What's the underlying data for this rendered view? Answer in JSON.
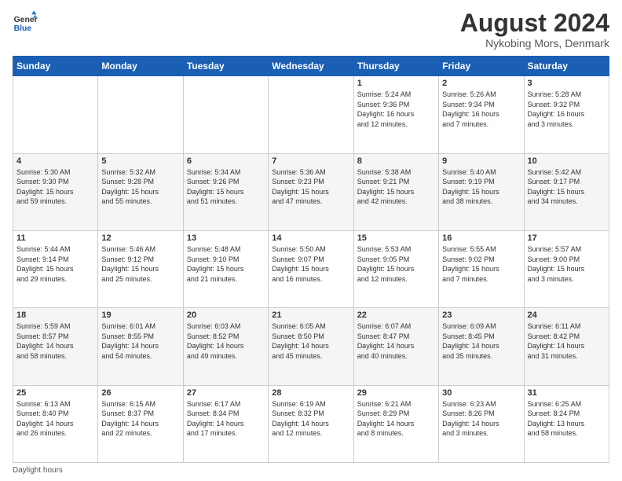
{
  "header": {
    "logo_line1": "General",
    "logo_line2": "Blue",
    "title": "August 2024",
    "subtitle": "Nykobing Mors, Denmark"
  },
  "calendar": {
    "days_of_week": [
      "Sunday",
      "Monday",
      "Tuesday",
      "Wednesday",
      "Thursday",
      "Friday",
      "Saturday"
    ],
    "weeks": [
      [
        {
          "day": "",
          "info": ""
        },
        {
          "day": "",
          "info": ""
        },
        {
          "day": "",
          "info": ""
        },
        {
          "day": "",
          "info": ""
        },
        {
          "day": "1",
          "info": "Sunrise: 5:24 AM\nSunset: 9:36 PM\nDaylight: 16 hours\nand 12 minutes."
        },
        {
          "day": "2",
          "info": "Sunrise: 5:26 AM\nSunset: 9:34 PM\nDaylight: 16 hours\nand 7 minutes."
        },
        {
          "day": "3",
          "info": "Sunrise: 5:28 AM\nSunset: 9:32 PM\nDaylight: 16 hours\nand 3 minutes."
        }
      ],
      [
        {
          "day": "4",
          "info": "Sunrise: 5:30 AM\nSunset: 9:30 PM\nDaylight: 15 hours\nand 59 minutes."
        },
        {
          "day": "5",
          "info": "Sunrise: 5:32 AM\nSunset: 9:28 PM\nDaylight: 15 hours\nand 55 minutes."
        },
        {
          "day": "6",
          "info": "Sunrise: 5:34 AM\nSunset: 9:26 PM\nDaylight: 15 hours\nand 51 minutes."
        },
        {
          "day": "7",
          "info": "Sunrise: 5:36 AM\nSunset: 9:23 PM\nDaylight: 15 hours\nand 47 minutes."
        },
        {
          "day": "8",
          "info": "Sunrise: 5:38 AM\nSunset: 9:21 PM\nDaylight: 15 hours\nand 42 minutes."
        },
        {
          "day": "9",
          "info": "Sunrise: 5:40 AM\nSunset: 9:19 PM\nDaylight: 15 hours\nand 38 minutes."
        },
        {
          "day": "10",
          "info": "Sunrise: 5:42 AM\nSunset: 9:17 PM\nDaylight: 15 hours\nand 34 minutes."
        }
      ],
      [
        {
          "day": "11",
          "info": "Sunrise: 5:44 AM\nSunset: 9:14 PM\nDaylight: 15 hours\nand 29 minutes."
        },
        {
          "day": "12",
          "info": "Sunrise: 5:46 AM\nSunset: 9:12 PM\nDaylight: 15 hours\nand 25 minutes."
        },
        {
          "day": "13",
          "info": "Sunrise: 5:48 AM\nSunset: 9:10 PM\nDaylight: 15 hours\nand 21 minutes."
        },
        {
          "day": "14",
          "info": "Sunrise: 5:50 AM\nSunset: 9:07 PM\nDaylight: 15 hours\nand 16 minutes."
        },
        {
          "day": "15",
          "info": "Sunrise: 5:53 AM\nSunset: 9:05 PM\nDaylight: 15 hours\nand 12 minutes."
        },
        {
          "day": "16",
          "info": "Sunrise: 5:55 AM\nSunset: 9:02 PM\nDaylight: 15 hours\nand 7 minutes."
        },
        {
          "day": "17",
          "info": "Sunrise: 5:57 AM\nSunset: 9:00 PM\nDaylight: 15 hours\nand 3 minutes."
        }
      ],
      [
        {
          "day": "18",
          "info": "Sunrise: 5:59 AM\nSunset: 8:57 PM\nDaylight: 14 hours\nand 58 minutes."
        },
        {
          "day": "19",
          "info": "Sunrise: 6:01 AM\nSunset: 8:55 PM\nDaylight: 14 hours\nand 54 minutes."
        },
        {
          "day": "20",
          "info": "Sunrise: 6:03 AM\nSunset: 8:52 PM\nDaylight: 14 hours\nand 49 minutes."
        },
        {
          "day": "21",
          "info": "Sunrise: 6:05 AM\nSunset: 8:50 PM\nDaylight: 14 hours\nand 45 minutes."
        },
        {
          "day": "22",
          "info": "Sunrise: 6:07 AM\nSunset: 8:47 PM\nDaylight: 14 hours\nand 40 minutes."
        },
        {
          "day": "23",
          "info": "Sunrise: 6:09 AM\nSunset: 8:45 PM\nDaylight: 14 hours\nand 35 minutes."
        },
        {
          "day": "24",
          "info": "Sunrise: 6:11 AM\nSunset: 8:42 PM\nDaylight: 14 hours\nand 31 minutes."
        }
      ],
      [
        {
          "day": "25",
          "info": "Sunrise: 6:13 AM\nSunset: 8:40 PM\nDaylight: 14 hours\nand 26 minutes."
        },
        {
          "day": "26",
          "info": "Sunrise: 6:15 AM\nSunset: 8:37 PM\nDaylight: 14 hours\nand 22 minutes."
        },
        {
          "day": "27",
          "info": "Sunrise: 6:17 AM\nSunset: 8:34 PM\nDaylight: 14 hours\nand 17 minutes."
        },
        {
          "day": "28",
          "info": "Sunrise: 6:19 AM\nSunset: 8:32 PM\nDaylight: 14 hours\nand 12 minutes."
        },
        {
          "day": "29",
          "info": "Sunrise: 6:21 AM\nSunset: 8:29 PM\nDaylight: 14 hours\nand 8 minutes."
        },
        {
          "day": "30",
          "info": "Sunrise: 6:23 AM\nSunset: 8:26 PM\nDaylight: 14 hours\nand 3 minutes."
        },
        {
          "day": "31",
          "info": "Sunrise: 6:25 AM\nSunset: 8:24 PM\nDaylight: 13 hours\nand 58 minutes."
        }
      ]
    ]
  },
  "footer": {
    "note": "Daylight hours"
  }
}
